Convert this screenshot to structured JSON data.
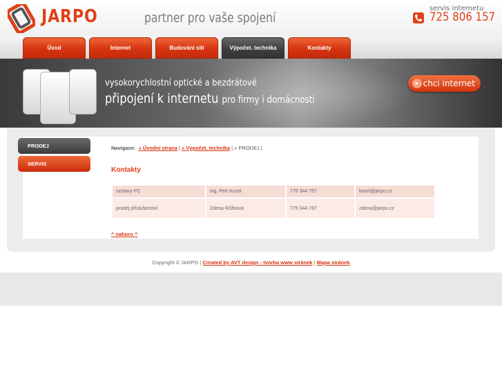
{
  "header": {
    "logo_text": "JARPO",
    "slogan": "partner pro vaše spojení",
    "servis_label": "servis internetu",
    "phone": "725 806 157"
  },
  "nav": {
    "tabs": [
      {
        "label": "Úvod",
        "active": false
      },
      {
        "label": "Internet",
        "active": false
      },
      {
        "label": "Budování sítí",
        "active": false
      },
      {
        "label": "Výpočet. technika",
        "active": true
      },
      {
        "label": "Kontakty",
        "active": false
      }
    ]
  },
  "banner": {
    "line1": "vysokorychlostní optické a bezdrátové",
    "line2_main": "připojení k internetu",
    "line2_small": "pro firmy i domácnosti",
    "cta_label": "chci internet"
  },
  "sidebar": {
    "items": [
      {
        "label": "PRODEJ"
      },
      {
        "label": "SERVIS"
      }
    ]
  },
  "breadcrumb": {
    "prefix": "Navigace:",
    "links": [
      "» Úvodní strana",
      "» Výpočet. technika"
    ],
    "current": "» PRODEJ"
  },
  "main": {
    "title": "Kontakty",
    "table": [
      [
        "sestavy PC",
        "ing. Petr Kozel",
        "775 344 797",
        "kozel@jarpo.cz"
      ],
      [
        "prodej příslušenství",
        "Zdena Růžková",
        "775 344 787",
        "zdena@jarpo.cz"
      ]
    ],
    "back_to_top": "^ nahoru ^"
  },
  "footer": {
    "copyright": "Copyright © JARPO |",
    "created_by": "Created by AVT design - tvorba www stránek",
    "sep": "|",
    "sitemap": "Mapa stránek"
  },
  "colors": {
    "accent": "#e0401a",
    "dark_tab": "#3f3f3f"
  }
}
